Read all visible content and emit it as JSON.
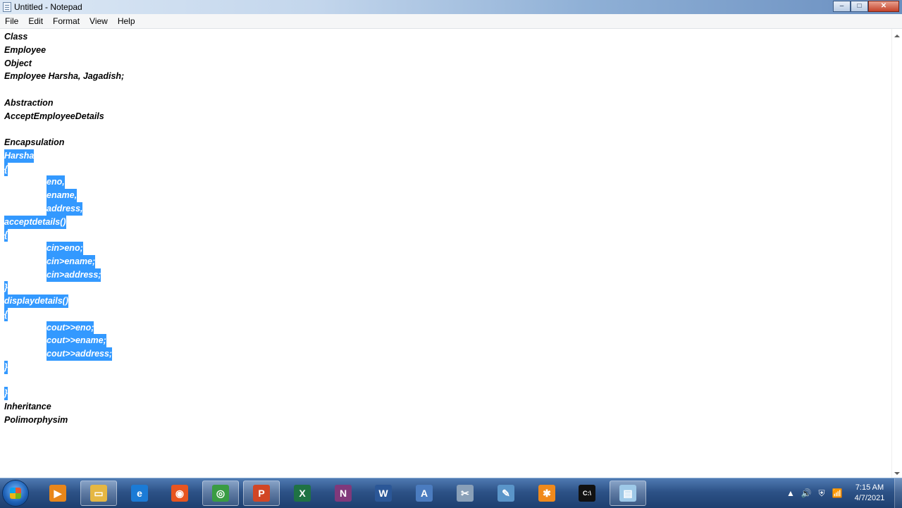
{
  "window": {
    "title": "Untitled - Notepad",
    "minimize": "–",
    "maximize": "□",
    "close": "✕"
  },
  "menu": [
    "File",
    "Edit",
    "Format",
    "View",
    "Help"
  ],
  "lines": [
    {
      "text": "Class",
      "indent": 0,
      "sel": false
    },
    {
      "text": "Employee",
      "indent": 0,
      "sel": false
    },
    {
      "text": "Object",
      "indent": 0,
      "sel": false
    },
    {
      "text": "Employee Harsha, Jagadish;",
      "indent": 0,
      "sel": false
    },
    {
      "text": "",
      "indent": 0,
      "sel": false
    },
    {
      "text": "Abstraction",
      "indent": 0,
      "sel": false
    },
    {
      "text": "AcceptEmployeeDetails",
      "indent": 0,
      "sel": false
    },
    {
      "text": "",
      "indent": 0,
      "sel": false
    },
    {
      "text": "Encapsulation",
      "indent": 0,
      "sel": false
    },
    {
      "text": "Harsha",
      "indent": 0,
      "sel": true
    },
    {
      "text": "{",
      "indent": 0,
      "sel": true
    },
    {
      "text": "eno,",
      "indent": 1,
      "sel": true
    },
    {
      "text": "ename,",
      "indent": 1,
      "sel": true
    },
    {
      "text": "address,",
      "indent": 1,
      "sel": true
    },
    {
      "text": "acceptdetails()",
      "indent": 0,
      "sel": true
    },
    {
      "text": "{",
      "indent": 0,
      "sel": true
    },
    {
      "text": "cin>eno;",
      "indent": 1,
      "sel": true
    },
    {
      "text": "cin>ename;",
      "indent": 1,
      "sel": true
    },
    {
      "text": "cin>address;",
      "indent": 1,
      "sel": true
    },
    {
      "text": "}",
      "indent": 0,
      "sel": true
    },
    {
      "text": "displaydetails()",
      "indent": 0,
      "sel": true
    },
    {
      "text": "{",
      "indent": 0,
      "sel": true
    },
    {
      "text": "cout>>eno;",
      "indent": 1,
      "sel": true
    },
    {
      "text": "cout>>ename;",
      "indent": 1,
      "sel": true
    },
    {
      "text": "cout>>address;",
      "indent": 1,
      "sel": true
    },
    {
      "text": "}",
      "indent": 0,
      "sel": true
    },
    {
      "text": "",
      "indent": 0,
      "sel": false
    },
    {
      "text": "}",
      "indent": 0,
      "sel": true
    },
    {
      "text": "Inheritance",
      "indent": 0,
      "sel": false
    },
    {
      "text": "Polimorphysim",
      "indent": 0,
      "sel": false
    }
  ],
  "taskbar": {
    "apps": [
      {
        "name": "media-player",
        "glyph": "▶",
        "color": "#e8861a"
      },
      {
        "name": "file-explorer",
        "glyph": "▭",
        "color": "#e5b743",
        "active": true
      },
      {
        "name": "internet-explorer",
        "glyph": "e",
        "color": "#1b7bd6"
      },
      {
        "name": "firefox",
        "glyph": "◉",
        "color": "#e8551f"
      },
      {
        "name": "chrome",
        "glyph": "◎",
        "color": "#3a9c43",
        "active": true
      },
      {
        "name": "powerpoint",
        "glyph": "P",
        "color": "#d24625",
        "active": true
      },
      {
        "name": "excel",
        "glyph": "X",
        "color": "#1f7244"
      },
      {
        "name": "onenote",
        "glyph": "N",
        "color": "#80397b"
      },
      {
        "name": "word",
        "glyph": "W",
        "color": "#2b5797"
      },
      {
        "name": "wordpad",
        "glyph": "A",
        "color": "#4b7cc0"
      },
      {
        "name": "snipping-tool",
        "glyph": "✂",
        "color": "#8aa0b8"
      },
      {
        "name": "paint",
        "glyph": "✎",
        "color": "#5a95c9"
      },
      {
        "name": "orange-app",
        "glyph": "✱",
        "color": "#f08a1c"
      },
      {
        "name": "command-prompt",
        "glyph": "C:\\",
        "color": "#111111"
      },
      {
        "name": "notepad",
        "glyph": "▤",
        "color": "#9ec9e8",
        "active": true
      }
    ],
    "tray": [
      "▲",
      "🔊",
      "⛨",
      "📶"
    ],
    "time": "7:15 AM",
    "date": "4/7/2021"
  }
}
